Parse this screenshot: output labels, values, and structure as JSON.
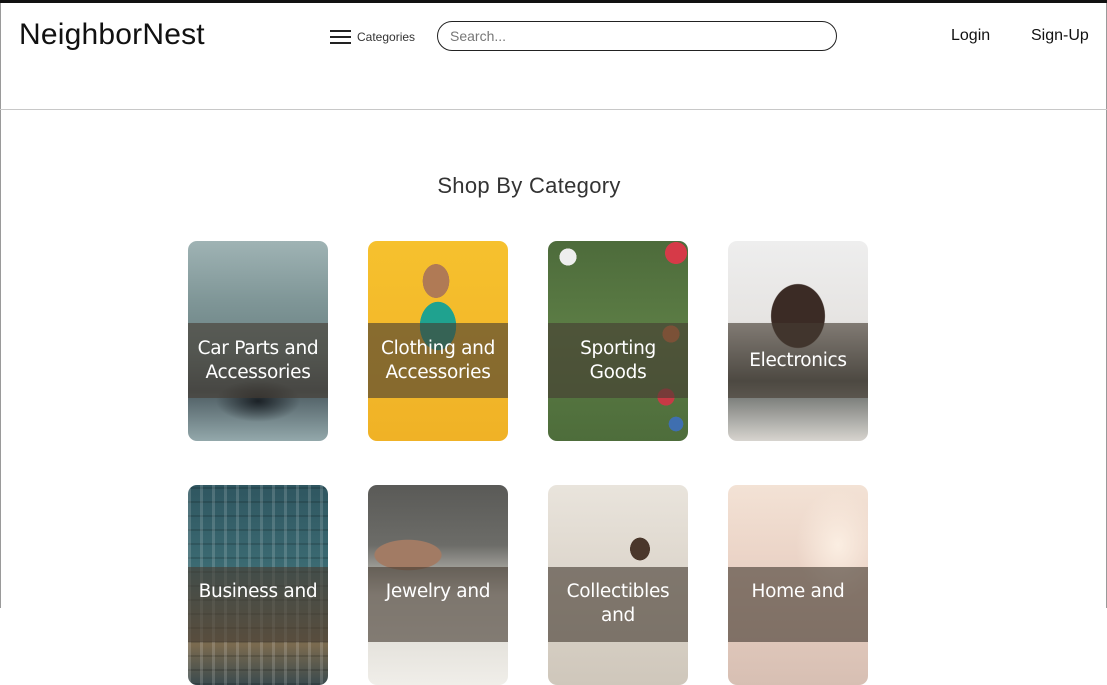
{
  "header": {
    "logo": "NeighborNest",
    "categories_label": "Categories",
    "search_placeholder": "Search...",
    "login_label": "Login",
    "signup_label": "Sign-Up"
  },
  "main": {
    "section_title": "Shop By Category",
    "categories": [
      {
        "label": "Car Parts and Accessories",
        "icon": "car-image"
      },
      {
        "label": "Clothing and Accessories",
        "icon": "clothing-image"
      },
      {
        "label": "Sporting Goods",
        "icon": "sports-image"
      },
      {
        "label": "Electronics",
        "icon": "electronics-image"
      },
      {
        "label": "Business and",
        "icon": "business-image"
      },
      {
        "label": "Jewelry and",
        "icon": "jewelry-image"
      },
      {
        "label": "Collectibles and",
        "icon": "collectibles-image"
      },
      {
        "label": "Home and",
        "icon": "home-image"
      }
    ]
  },
  "colors": {
    "band_overlay": "#463c32",
    "text": "#111111",
    "border": "#c8c8c8"
  }
}
